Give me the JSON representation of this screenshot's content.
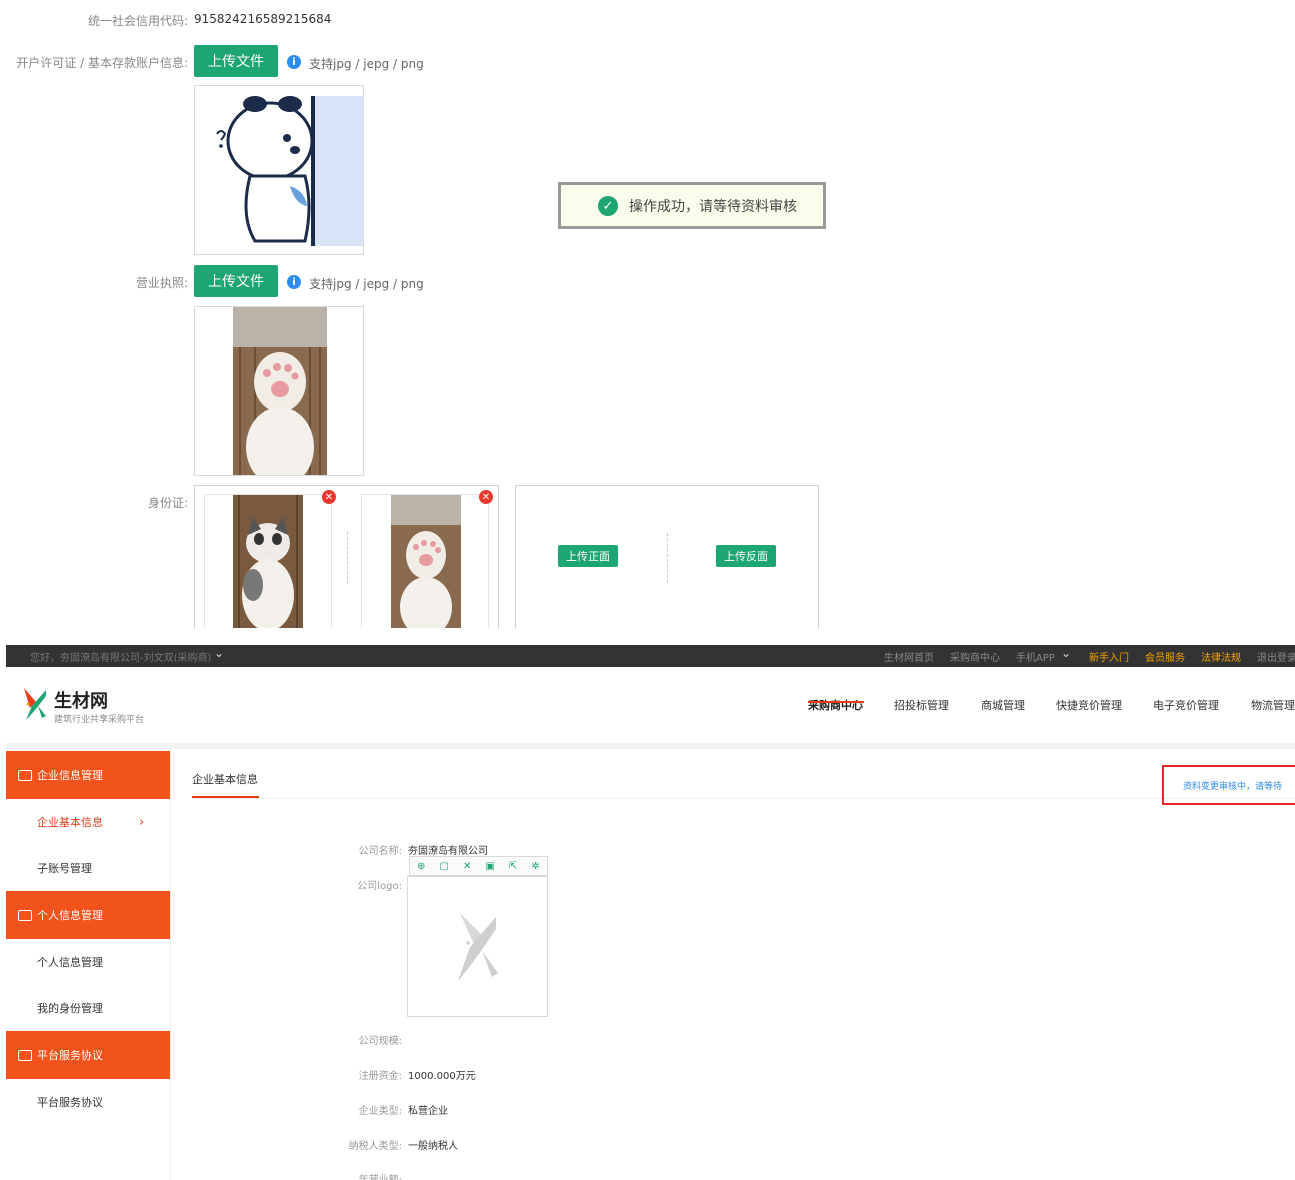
{
  "form": {
    "credit_code_label": "统一社会信用代码:",
    "credit_code_value": "915824216589215684",
    "license_label": "开户许可证 / 基本存款账户信息:",
    "business_label": "营业执照:",
    "idcard_label": "身份证:",
    "upload_button": "上传文件",
    "format_hint": "支持jpg / jepg / png",
    "upload_front": "上传正面",
    "upload_back": "上传反面",
    "toast": "操作成功，请等待资料审核"
  },
  "topbar": {
    "greeting": "您好，夯固潦岛有限公司-刘文双(采购商)",
    "links": [
      "生材网首页",
      "采购商中心",
      "手机APP",
      "新手入门",
      "会员服务",
      "法律法规",
      "退出登录"
    ]
  },
  "brand": {
    "name": "生材网",
    "tagline": "建筑行业共享采购平台"
  },
  "nav": [
    "采购商中心",
    "招投标管理",
    "商城管理",
    "快捷竞价管理",
    "电子竞价管理",
    "物流管理"
  ],
  "sidebar": {
    "groups": [
      {
        "label": "企业信息管理",
        "items": [
          "企业基本信息",
          "子账号管理"
        ]
      },
      {
        "label": "个人信息管理",
        "items": [
          "个人信息管理",
          "我的身份管理"
        ]
      },
      {
        "label": "平台服务协议",
        "items": [
          "平台服务协议"
        ]
      }
    ]
  },
  "content": {
    "tab": "企业基本信息",
    "notice": "资料变更审核中，请等待",
    "fields": {
      "company_name_label": "公司名称:",
      "company_name": "夯固潦岛有限公司",
      "logo_label": "公司logo:",
      "scale_label": "公司规模:",
      "capital_label": "注册资金:",
      "capital": "1000.000万元",
      "type_label": "企业类型:",
      "type": "私营企业",
      "taxpayer_label": "纳税人类型:",
      "taxpayer": "一般纳税人",
      "revenue_label": "年营业额:"
    }
  },
  "colors": {
    "primary_green": "#1da672",
    "brand_orange": "#f2521b",
    "accent_red": "#e63e1a",
    "link_blue": "#2d8cf0"
  }
}
